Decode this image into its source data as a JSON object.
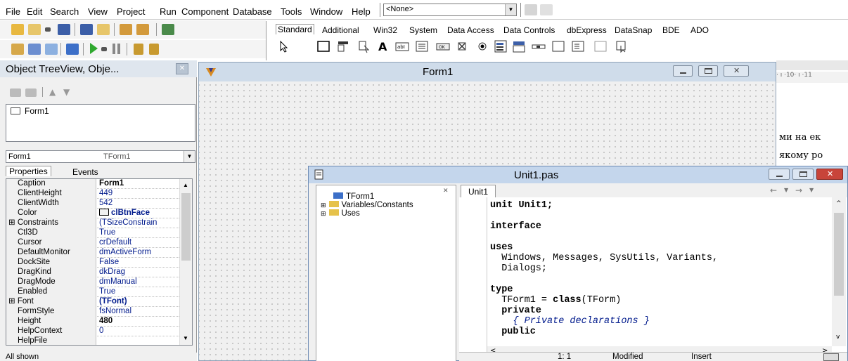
{
  "menu": [
    "File",
    "Edit",
    "Search",
    "View",
    "Project",
    "Run",
    "Component",
    "Database",
    "Tools",
    "Window",
    "Help"
  ],
  "toolbar": {
    "component_combo": "<None>"
  },
  "palette": {
    "tabs": [
      "Standard",
      "Additional",
      "Win32",
      "System",
      "Data Access",
      "Data Controls",
      "dbExpress",
      "DataSnap",
      "BDE",
      "ADO"
    ],
    "icons": [
      "pointer-icon",
      "frames-icon",
      "main-menu-icon",
      "popup-menu-icon",
      "label-icon",
      "edit-icon",
      "memo-icon",
      "button-icon",
      "checkbox-icon",
      "radio-icon",
      "listbox-icon",
      "combobox-icon",
      "scrollbar-icon",
      "groupbox-icon",
      "radiogroup-icon",
      "panel-icon",
      "actionlist-icon"
    ]
  },
  "object_inspector": {
    "title": "Object TreeView, Obje...",
    "tree_items": [
      "Form1"
    ],
    "selected_object": {
      "name": "Form1",
      "type": "TForm1"
    },
    "tabs": [
      "Properties",
      "Events"
    ],
    "properties": [
      {
        "name": "Caption",
        "value": "Form1",
        "bold": true
      },
      {
        "name": "ClientHeight",
        "value": "449"
      },
      {
        "name": "ClientWidth",
        "value": "542"
      },
      {
        "name": "Color",
        "value": "clBtnFace",
        "bold": true,
        "swatch": true
      },
      {
        "name": "Constraints",
        "value": "(TSizeConstrain",
        "expandable": true
      },
      {
        "name": "Ctl3D",
        "value": "True"
      },
      {
        "name": "Cursor",
        "value": "crDefault"
      },
      {
        "name": "DefaultMonitor",
        "value": "dmActiveForm"
      },
      {
        "name": "DockSite",
        "value": "False"
      },
      {
        "name": "DragKind",
        "value": "dkDrag"
      },
      {
        "name": "DragMode",
        "value": "dmManual"
      },
      {
        "name": "Enabled",
        "value": "True"
      },
      {
        "name": "Font",
        "value": "(TFont)",
        "bold": true,
        "expandable": true
      },
      {
        "name": "FormStyle",
        "value": "fsNormal"
      },
      {
        "name": "Height",
        "value": "480",
        "bold": true
      },
      {
        "name": "HelpContext",
        "value": "0"
      },
      {
        "name": "HelpFile",
        "value": ""
      }
    ],
    "status": "All shown"
  },
  "form_designer": {
    "title": "Form1"
  },
  "code_editor": {
    "title": "Unit1.pas",
    "tab": "Unit1",
    "explorer_items": [
      "TForm1",
      "Variables/Constants",
      "Uses"
    ],
    "code_lines": [
      {
        "text": "unit Unit1;",
        "kind": "kw-first"
      },
      {
        "text": "",
        "kind": "plain"
      },
      {
        "text": "interface",
        "kind": "kw"
      },
      {
        "text": "",
        "kind": "plain"
      },
      {
        "text": "uses",
        "kind": "kw"
      },
      {
        "text": "  Windows, Messages, SysUtils, Variants,",
        "kind": "plain"
      },
      {
        "text": "  Dialogs;",
        "kind": "plain"
      },
      {
        "text": "",
        "kind": "plain"
      },
      {
        "text": "type",
        "kind": "kw"
      },
      {
        "text": "  TForm1 = class(TForm)",
        "kind": "class"
      },
      {
        "text": "  private",
        "kind": "kw"
      },
      {
        "text": "    { Private declarations }",
        "kind": "comment"
      },
      {
        "text": "  public",
        "kind": "kw"
      }
    ],
    "status": {
      "position": "1: 1",
      "modified": "Modified",
      "mode": "Insert"
    }
  },
  "background_document": {
    "ruler": "· ı ·10· ı ·11",
    "line1": "ми на ек",
    "line2": "якому ро"
  },
  "colors": {
    "title_active": "#c4d6ec",
    "value_text": "#001a8c",
    "close_red": "#c8443a"
  }
}
